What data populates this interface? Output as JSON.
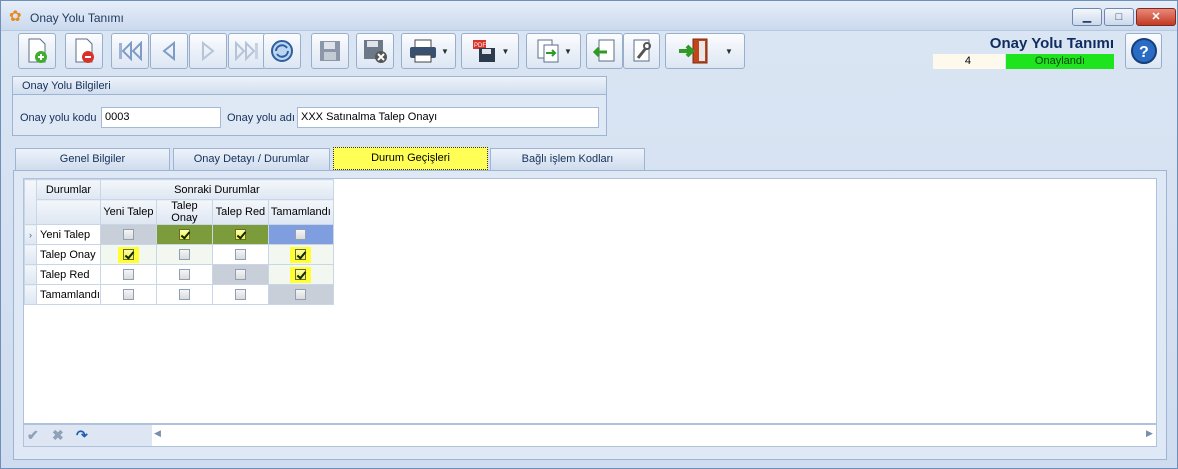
{
  "window": {
    "title": "Onay Yolu Tanımı",
    "minimize": "▁",
    "maximize": "□",
    "close": "✕"
  },
  "header": {
    "form_title": "Onay Yolu Tanımı",
    "record_number": "4",
    "status": "Onaylandı"
  },
  "toolbar": {
    "icons": [
      "new-document-icon",
      "delete-document-icon",
      "first-record-icon",
      "previous-record-icon",
      "next-record-icon",
      "last-record-icon",
      "refresh-icon",
      "save-icon",
      "save-close-icon",
      "print-icon",
      "pdf-export-icon",
      "document-transfer-icon",
      "import-icon",
      "tools-icon",
      "exit-door-icon",
      "help-icon"
    ]
  },
  "group": {
    "title": "Onay Yolu Bilgileri",
    "code_label": "Onay yolu kodu",
    "code_value": "0003",
    "name_label": "Onay yolu adı",
    "name_value": "XXX Satınalma Talep Onayı"
  },
  "tabs": [
    "Genel Bilgiler",
    "Onay Detayı / Durumlar",
    "Durum Geçişleri",
    "Bağlı işlem Kodları"
  ],
  "active_tab": "Durum Geçişleri",
  "grid": {
    "col_header_rows": "Durumlar",
    "col_header_group": "Sonraki Durumlar",
    "columns": [
      "Yeni Talep",
      "Talep Onay",
      "Talep Red",
      "Tamamlandı"
    ],
    "rows": [
      {
        "name": "Yeni Talep",
        "values": [
          false,
          true,
          true,
          false
        ],
        "current": true
      },
      {
        "name": "Talep Onay",
        "values": [
          true,
          false,
          false,
          true
        ]
      },
      {
        "name": "Talep Red",
        "values": [
          false,
          false,
          false,
          true
        ]
      },
      {
        "name": "Tamamlandı",
        "values": [
          false,
          false,
          false,
          false
        ]
      }
    ],
    "row_indicator": "›"
  },
  "gridnav": {
    "accept": "✔",
    "cancel": "✖",
    "undo": "↷",
    "scroll_left": "◀",
    "scroll_right": "▶"
  }
}
